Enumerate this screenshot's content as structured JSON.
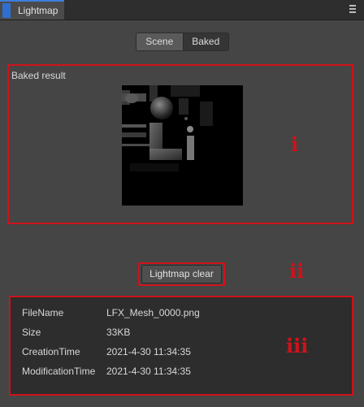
{
  "panel": {
    "tab_label": "Lightmap",
    "menu_icon": "hamburger-menu-icon"
  },
  "toggle": {
    "options": [
      "Scene",
      "Baked"
    ],
    "selected": "Scene"
  },
  "baked_section": {
    "label": "Baked result",
    "preview_text": "Li"
  },
  "actions": {
    "clear_label": "Lightmap clear"
  },
  "annotations": {
    "markers": [
      "i",
      "ii",
      "iii"
    ],
    "highlight_color": "#d0121b"
  },
  "file_info": {
    "rows": [
      {
        "key": "FileName",
        "value": "LFX_Mesh_0000.png"
      },
      {
        "key": "Size",
        "value": "33KB"
      },
      {
        "key": "CreationTime",
        "value": "2021-4-30 11:34:35"
      },
      {
        "key": "ModificationTime",
        "value": "2021-4-30 11:34:35"
      }
    ]
  }
}
